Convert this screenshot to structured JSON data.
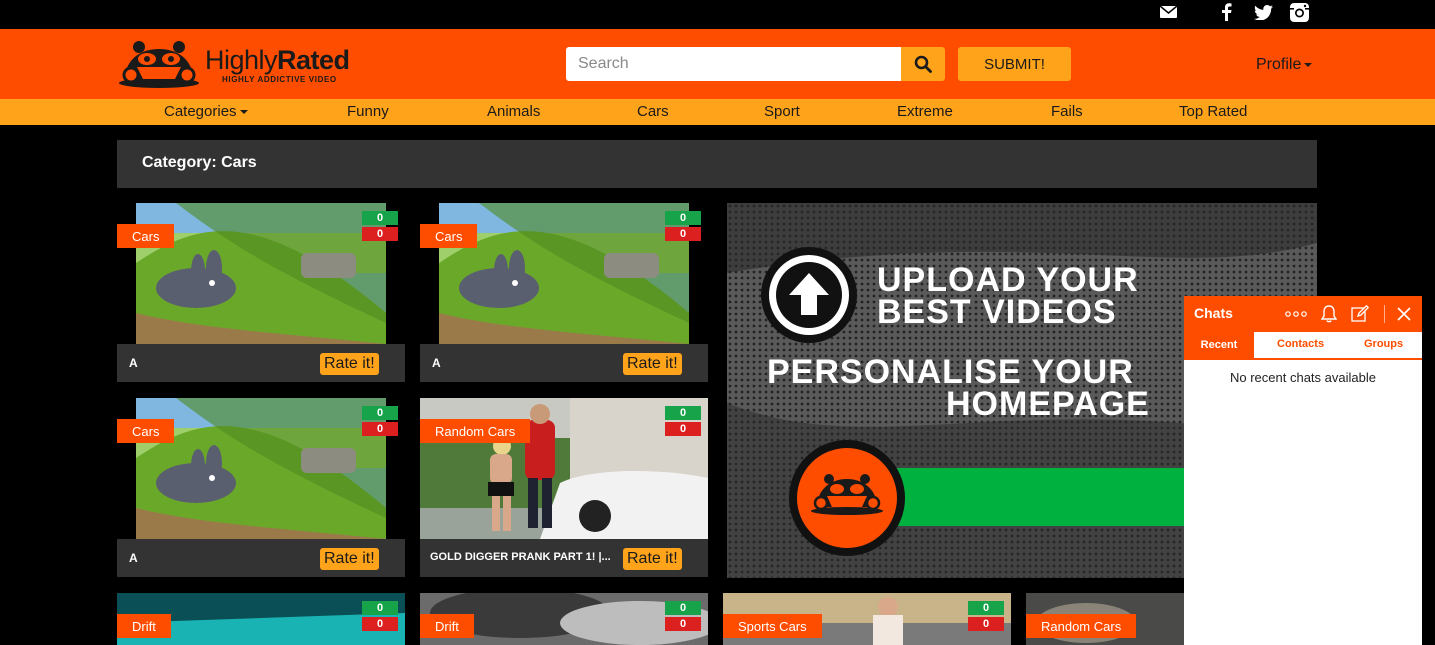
{
  "brand": {
    "name_light": "Highly",
    "name_bold": "Rated",
    "tagline": "HIGHLY ADDICTIVE VIDEO"
  },
  "search": {
    "placeholder": "Search"
  },
  "submit_label": "SUBMIT!",
  "profile_label": "Profile",
  "nav": [
    "Categories",
    "Funny",
    "Animals",
    "Cars",
    "Sport",
    "Extreme",
    "Fails",
    "Top Rated"
  ],
  "category_title": "Category: Cars",
  "cards": [
    {
      "tag": "Cars",
      "up": "0",
      "down": "0",
      "title": "A",
      "rate": "Rate it!"
    },
    {
      "tag": "Cars",
      "up": "0",
      "down": "0",
      "title": "A",
      "rate": "Rate it!"
    },
    {
      "tag": "Cars",
      "up": "0",
      "down": "0",
      "title": "A",
      "rate": "Rate it!"
    },
    {
      "tag": "Random Cars",
      "up": "0",
      "down": "0",
      "title": "GOLD DIGGER PRANK PART 1! |...",
      "rate": "Rate it!"
    }
  ],
  "bottom_cards": [
    {
      "tag": "Drift",
      "up": "0",
      "down": "0"
    },
    {
      "tag": "Drift",
      "up": "0",
      "down": "0"
    },
    {
      "tag": "Sports Cars",
      "up": "0",
      "down": "0"
    },
    {
      "tag": "Random Cars"
    }
  ],
  "promo": {
    "line1": "UPLOAD YOUR",
    "line2": "BEST VIDEOS",
    "line3": "PERSONALISE YOUR",
    "line4": "HOMEPAGE"
  },
  "chat": {
    "title": "Chats",
    "tabs": [
      "Recent",
      "Contacts",
      "Groups"
    ],
    "empty": "No recent chats available"
  },
  "colors": {
    "primary": "#ff4d00",
    "accent": "#ffa31a",
    "panel": "#333333",
    "up": "#16a34a",
    "down": "#dc1f1f"
  }
}
